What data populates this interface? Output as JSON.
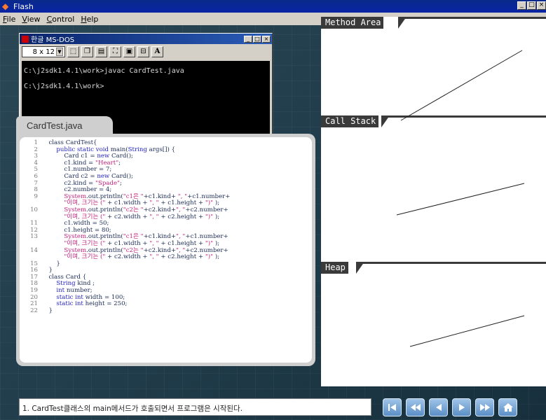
{
  "window": {
    "title": "Flash"
  },
  "menu": [
    {
      "label": "File",
      "key": "F"
    },
    {
      "label": "View",
      "key": "V"
    },
    {
      "label": "Control",
      "key": "C"
    },
    {
      "label": "Help",
      "key": "H"
    }
  ],
  "dos": {
    "title": "한글 MS-DOS",
    "font_size": "8 x 12",
    "lines": [
      "C:\\j2sdk1.4.1\\work>javac CardTest.java",
      "C:\\j2sdk1.4.1\\work>"
    ],
    "toolbar_bold": "A"
  },
  "code": {
    "tab": "CardTest.java",
    "lines": [
      {
        "n": "1",
        "t": "  class CardTest{"
      },
      {
        "n": "2",
        "t": "      public static void main(String args[]) {"
      },
      {
        "n": "3",
        "t": "          Card c1 = new Card();"
      },
      {
        "n": "4",
        "t": "          c1.kind = \"Heart\";"
      },
      {
        "n": "5",
        "t": "          c1.number = 7;"
      },
      {
        "n": "6",
        "t": "          Card c2 = new Card();"
      },
      {
        "n": "7",
        "t": "          c2.kind = \"Spade\";"
      },
      {
        "n": "8",
        "t": "          c2.number = 4;"
      },
      {
        "n": "9",
        "t": "          System.out.println(\"c1은 \"+c1.kind+ \", \"+c1.number+"
      },
      {
        "n": "",
        "t": "          \"이며, 크기는 (\" + c1.width + \", \" + c1.height + \")\" );"
      },
      {
        "n": "10",
        "t": "          System.out.println(\"c2는 \"+c2.kind+\", \"+c2.number+"
      },
      {
        "n": "",
        "t": "          \"이며, 크기는 (\" + c2.width + \", \" + c2.height + \")\" );"
      },
      {
        "n": "11",
        "t": "          c1.width = 50;"
      },
      {
        "n": "12",
        "t": "          c1.height = 80;"
      },
      {
        "n": "13",
        "t": "          System.out.println(\"c1은 \"+c1.kind+\", \"+c1.number+"
      },
      {
        "n": "",
        "t": "          \"이며, 크기는 (\" + c1.width + \", \" + c1.height + \")\" );"
      },
      {
        "n": "14",
        "t": "          System.out.println(\"c2는 \"+c2.kind+\", \"+c2.number+"
      },
      {
        "n": "",
        "t": "          \"이며, 크기는 (\" + c2.width + \", \" + c2.height + \")\" );"
      },
      {
        "n": "15",
        "t": "      }"
      },
      {
        "n": "16",
        "t": "  }"
      },
      {
        "n": "17",
        "t": "  class Card {"
      },
      {
        "n": "18",
        "t": "      String kind ;"
      },
      {
        "n": "19",
        "t": "      int number;"
      },
      {
        "n": "20",
        "t": "      static int width = 100;"
      },
      {
        "n": "21",
        "t": "      static int height = 250;"
      },
      {
        "n": "22",
        "t": "  }"
      }
    ]
  },
  "memory": {
    "method_area": "Method Area",
    "call_stack": "Call Stack",
    "heap": "Heap"
  },
  "status_text": "1. CardTest클래스의 main메서드가 호출되면서 프로그램은 시작된다.",
  "nav_buttons": [
    {
      "name": "first-icon"
    },
    {
      "name": "rewind-icon"
    },
    {
      "name": "previous-icon"
    },
    {
      "name": "next-icon"
    },
    {
      "name": "fast-forward-icon"
    },
    {
      "name": "home-icon"
    }
  ],
  "colors": {
    "accent": "#0a246a",
    "panel_label": "#3a3a3a",
    "nav": "#5b8fc6"
  }
}
